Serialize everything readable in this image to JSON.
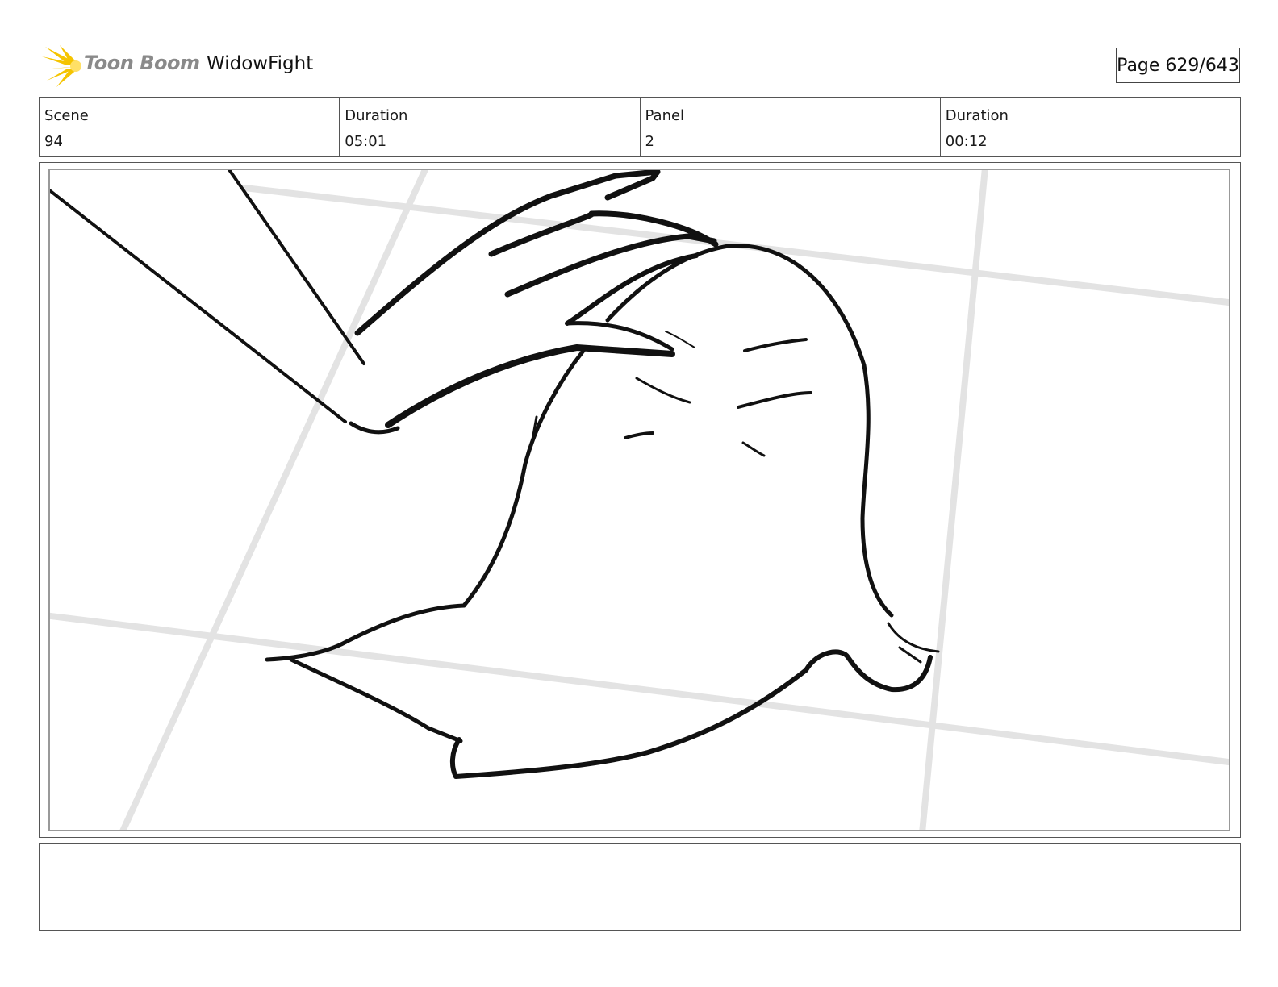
{
  "header": {
    "logo_text": "Toon Boom",
    "project_title": "WidowFight",
    "page_label": "Page 629/643"
  },
  "info": {
    "scene_label": "Scene",
    "scene_value": "94",
    "scene_duration_label": "Duration",
    "scene_duration_value": "05:01",
    "panel_label": "Panel",
    "panel_value": "2",
    "panel_duration_label": "Duration",
    "panel_duration_value": "00:12"
  },
  "notes": {
    "text": ""
  },
  "colors": {
    "logo_star": "#f5c400",
    "logo_text": "#8a8a8a",
    "border": "#555555",
    "sketch_line": "#111111",
    "floor_grid": "#e3e3e3"
  }
}
